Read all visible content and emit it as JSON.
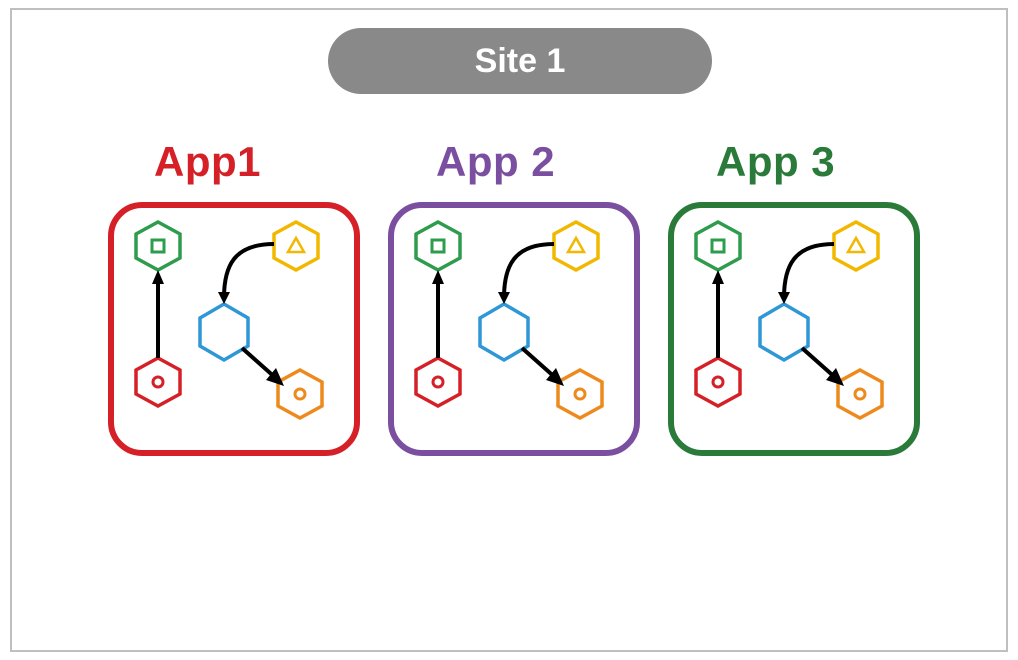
{
  "site_title": "Site 1",
  "apps": [
    {
      "label": "App1",
      "color": "#d62027"
    },
    {
      "label": "App 2",
      "color": "#7a4fa0"
    },
    {
      "label": "App 3",
      "color": "#2a7a3a"
    }
  ],
  "schematic_nodes": {
    "top_left_hex": {
      "color": "green",
      "inner": "square"
    },
    "top_right_hex": {
      "color": "yellow",
      "inner": "triangle"
    },
    "center_hex": {
      "color": "blue",
      "inner": "none"
    },
    "bottom_left_hex": {
      "color": "red",
      "inner": "circle"
    },
    "bottom_right_hex": {
      "color": "orange",
      "inner": "circle"
    }
  },
  "schematic_arrows": [
    "top_right_hex -> center_hex (curved)",
    "bottom_left_hex -> top_left_hex",
    "center_hex -> bottom_right_hex"
  ]
}
